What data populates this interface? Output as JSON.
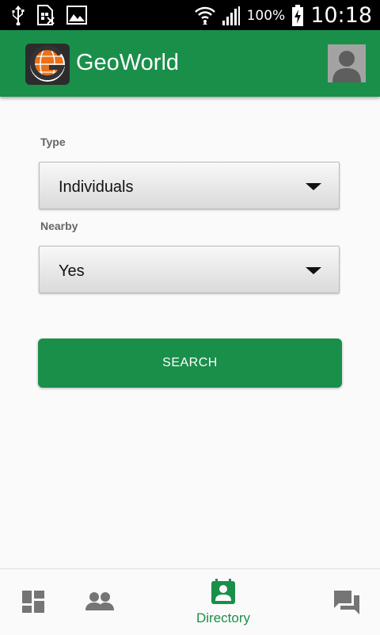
{
  "status_bar": {
    "battery_percent": "100%",
    "time": "10:18",
    "icons": [
      "usb-icon",
      "sim-icon",
      "image-icon",
      "wifi-icon",
      "signal-icon",
      "battery-charging-icon"
    ]
  },
  "app_bar": {
    "title": "GeoWorld",
    "logo_icon": "globe-logo-icon",
    "avatar_icon": "user-avatar-icon"
  },
  "form": {
    "type_label": "Type",
    "type_value": "Individuals",
    "nearby_label": "Nearby",
    "nearby_value": "Yes",
    "search_label": "SEARCH"
  },
  "bottom_nav": {
    "items": [
      {
        "icon": "dashboard-icon",
        "label": "",
        "active": false
      },
      {
        "icon": "people-icon",
        "label": "",
        "active": false
      },
      {
        "icon": "contacts-icon",
        "label": "Directory",
        "active": true
      },
      {
        "icon": "chat-icon",
        "label": "",
        "active": false
      }
    ]
  },
  "colors": {
    "primary": "#1a8f4a",
    "inactive_icon": "#757575"
  }
}
